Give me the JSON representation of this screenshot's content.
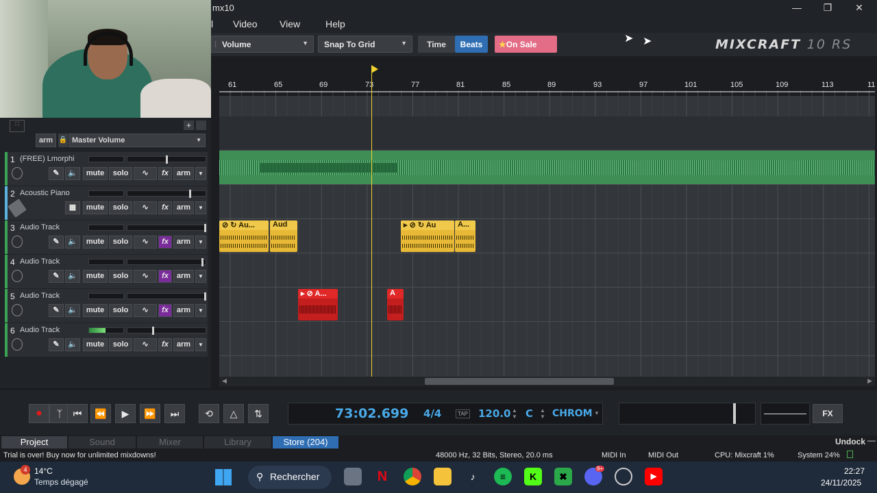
{
  "window": {
    "title": "mx10",
    "controls": [
      "minimize",
      "maximize",
      "close"
    ]
  },
  "menu": [
    "Video",
    "View",
    "Help"
  ],
  "menu_partial_left": "l",
  "toolbar": {
    "automation_select": "Volume",
    "snap_select": "Snap To Grid",
    "time_label": "Time",
    "beats_label": "Beats",
    "sale_label": "On Sale",
    "logo_main": "MIXCRAFT",
    "logo_sub": "10 RS"
  },
  "master": {
    "arm_label": "arm",
    "volume_label": "Master Volume"
  },
  "tracks": [
    {
      "num": "1",
      "name": "(FREE) Lmorphi",
      "mute": "mute",
      "solo": "solo",
      "fx": "fx",
      "arm": "arm",
      "fx_active": false
    },
    {
      "num": "2",
      "name": "Acoustic Piano",
      "mute": "mute",
      "solo": "solo",
      "fx": "fx",
      "arm": "arm",
      "fx_active": false
    },
    {
      "num": "3",
      "name": "Audio Track",
      "mute": "mute",
      "solo": "solo",
      "fx": "fx",
      "arm": "arm",
      "fx_active": true
    },
    {
      "num": "4",
      "name": "Audio Track",
      "mute": "mute",
      "solo": "solo",
      "fx": "fx",
      "arm": "arm",
      "fx_active": true
    },
    {
      "num": "5",
      "name": "Audio Track",
      "mute": "mute",
      "solo": "solo",
      "fx": "fx",
      "arm": "arm",
      "fx_active": true
    },
    {
      "num": "6",
      "name": "Audio Track",
      "mute": "mute",
      "solo": "solo",
      "fx": "fx",
      "arm": "arm",
      "fx_active": false
    }
  ],
  "ruler": [
    "61",
    "65",
    "69",
    "73",
    "77",
    "81",
    "85",
    "89",
    "93",
    "97",
    "101",
    "105",
    "109",
    "113",
    "11"
  ],
  "clips": {
    "t3a": "Au...",
    "t3b": "Aud",
    "t3c": "Au",
    "t3d": "A...",
    "t5a": "A...",
    "t5b": "A"
  },
  "transport": {
    "time": "73:02.699",
    "signature": "4/4",
    "tap": "TAP",
    "tempo": "120.0",
    "key": "C",
    "scale": "CHROM",
    "fx_label": "FX"
  },
  "tabs": [
    "Project",
    "Sound",
    "Mixer",
    "Library",
    "Store (204)"
  ],
  "undock_label": "Undock",
  "status": {
    "trial": "Trial is over!  Buy now for unlimited mixdowns!",
    "audio": "48000 Hz, 32 Bits, Stereo, 20.0 ms",
    "midi_in": "MIDI In",
    "midi_out": "MIDI Out",
    "cpu": "CPU: Mixcraft 1%",
    "system": "System 24%"
  },
  "taskbar": {
    "weather_temp": "14°C",
    "weather_desc": "Temps dégagé",
    "weather_badge": "4",
    "search_label": "Rechercher",
    "time": "22:27",
    "date": "24/11/2025",
    "discord_badge": "9+"
  },
  "colors": {
    "accent_blue": "#2f6eb3",
    "clip_yellow": "#e8b936",
    "clip_red": "#c41e1e",
    "track_green": "#3e8e55",
    "playhead": "#f2d230"
  }
}
